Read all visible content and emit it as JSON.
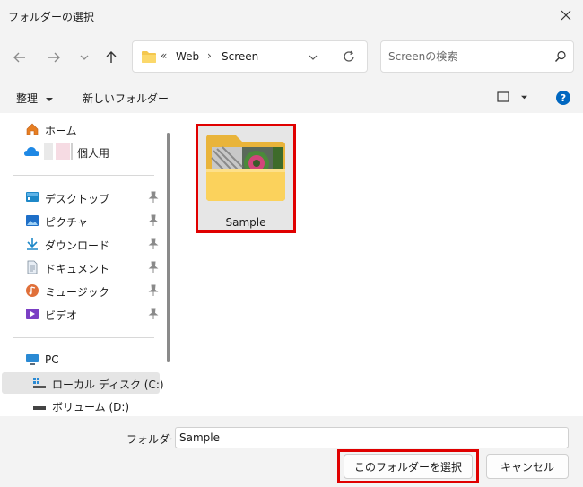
{
  "window": {
    "title": "フォルダーの選択"
  },
  "address_bar": {
    "overflow": "«",
    "crumbs": [
      "Web",
      "Screen"
    ],
    "separator": "›"
  },
  "search": {
    "placeholder": "Screenの検索"
  },
  "toolbar": {
    "organize": "整理",
    "new_folder": "新しいフォルダー"
  },
  "sidebar": {
    "home": "ホーム",
    "personal": "個人用",
    "quick": [
      {
        "label": "デスクトップ"
      },
      {
        "label": "ピクチャ"
      },
      {
        "label": "ダウンロード"
      },
      {
        "label": "ドキュメント"
      },
      {
        "label": "ミュージック"
      },
      {
        "label": "ビデオ"
      }
    ],
    "pc": "PC",
    "local_disk": "ローカル ディスク (C:)",
    "volume": "ボリューム (D:)"
  },
  "content": {
    "folders": [
      {
        "name": "Sample"
      }
    ]
  },
  "bottom": {
    "folder_label": "フォルダー:",
    "folder_value": "Sample",
    "select_button": "このフォルダーを選択",
    "cancel_button": "キャンセル"
  },
  "colors": {
    "highlight": "#e00000",
    "accent": "#0067c0",
    "folder": "#f4c74e"
  }
}
